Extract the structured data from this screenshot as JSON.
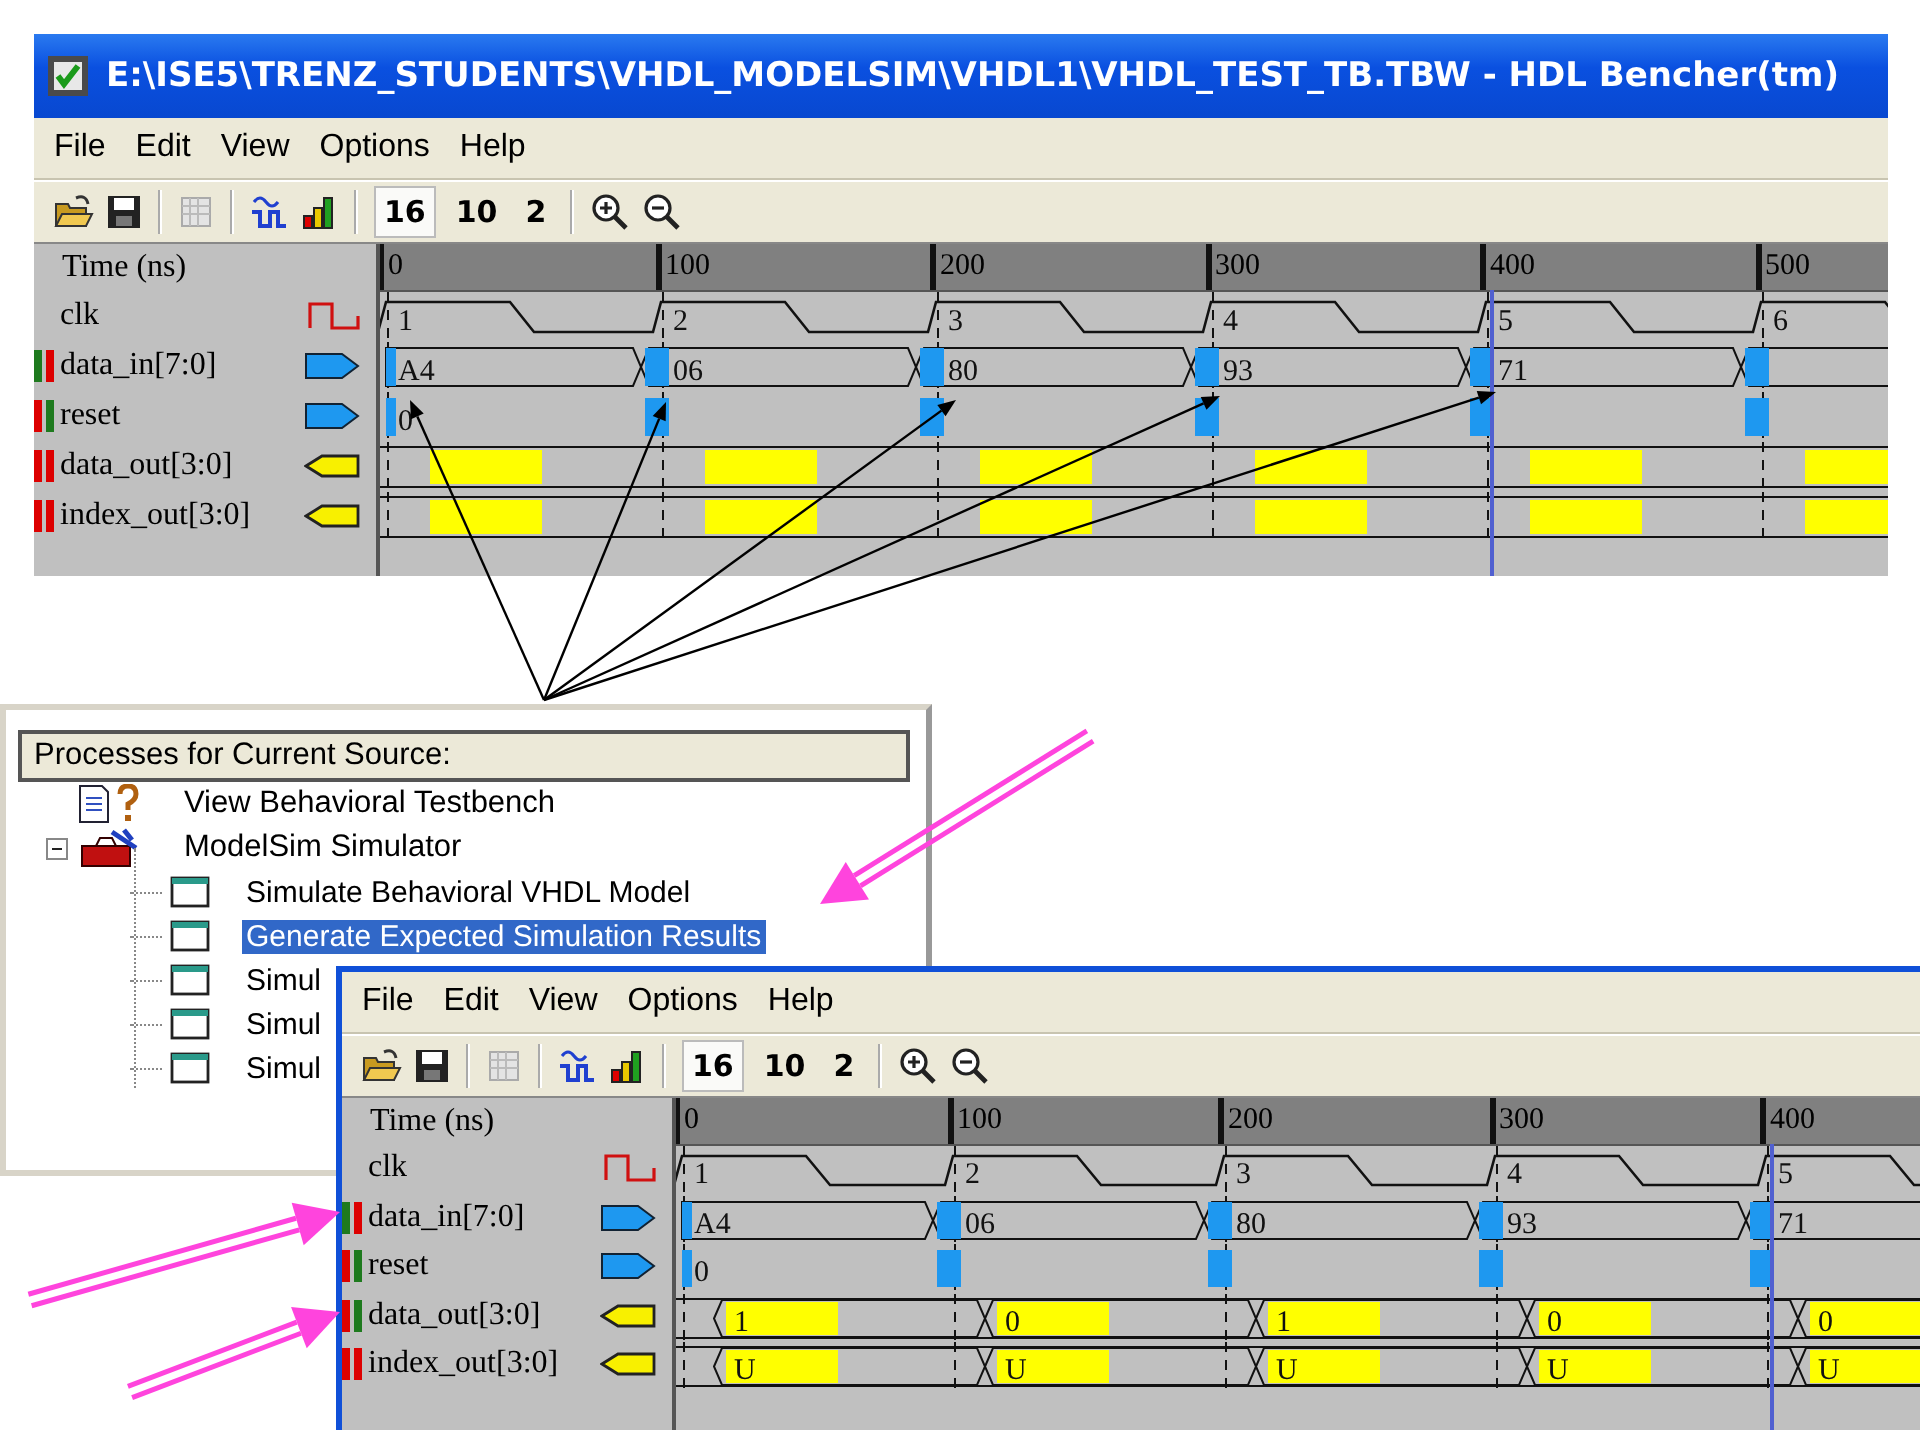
{
  "top_window": {
    "title": "E:\\ISE5\\TRENZ_STUDENTS\\VHDL_MODELSIM\\VHDL1\\VHDL_TEST_TB.TBW - HDL Bencher(tm)",
    "menu": [
      "File",
      "Edit",
      "View",
      "Options",
      "Help"
    ],
    "radix_buttons": [
      {
        "label": "16",
        "selected": true
      },
      {
        "label": "10",
        "selected": false
      },
      {
        "label": "2",
        "selected": false
      }
    ],
    "time_label": "Time (ns)",
    "ticks": [
      {
        "label": "0",
        "cursor": false
      },
      {
        "label": "100",
        "cursor": false
      },
      {
        "label": "200",
        "cursor": false
      },
      {
        "label": "300",
        "cursor": false
      },
      {
        "label": "400",
        "cursor": true
      },
      {
        "label": "500",
        "cursor": false
      }
    ],
    "signals": [
      {
        "name": "clk",
        "kind": "clock",
        "segments": [
          {
            "value": "1"
          },
          {
            "value": "2"
          },
          {
            "value": "3"
          },
          {
            "value": "4"
          },
          {
            "value": "5"
          },
          {
            "value": "6"
          }
        ]
      },
      {
        "name": "data_in[7:0]",
        "kind": "input_bus",
        "markers": [
          {
            "color": "#1e7a1e"
          },
          {
            "color": "#dd0000"
          }
        ],
        "segments": [
          {
            "value": "A4",
            "highlighted": true
          },
          {
            "value": "06",
            "highlighted": true
          },
          {
            "value": "80",
            "highlighted": true
          },
          {
            "value": "93",
            "highlighted": true
          },
          {
            "value": "71",
            "highlighted": true
          },
          {
            "highlighted": true
          }
        ]
      },
      {
        "name": "reset",
        "kind": "input_bit",
        "markers": [
          {
            "color": "#dd0000"
          },
          {
            "color": "#1e7a1e"
          }
        ],
        "segments": [
          {
            "value": "0",
            "highlighted": true
          },
          {
            "highlighted": true
          },
          {
            "highlighted": true
          },
          {
            "highlighted": true
          },
          {
            "highlighted": true
          },
          {
            "highlighted": true
          }
        ]
      },
      {
        "name": "data_out[3:0]",
        "kind": "output",
        "markers": [
          {
            "color": "#dd0000"
          },
          {
            "color": "#dd0000"
          }
        ],
        "segments": [
          {
            "highlighted": true
          },
          {
            "highlighted": true
          },
          {
            "highlighted": true
          },
          {
            "highlighted": true
          },
          {
            "highlighted": true
          },
          {
            "highlighted": true
          }
        ]
      },
      {
        "name": "index_out[3:0]",
        "kind": "output",
        "markers": [
          {
            "color": "#dd0000"
          },
          {
            "color": "#dd0000"
          }
        ],
        "segments": [
          {
            "highlighted": true
          },
          {
            "highlighted": true
          },
          {
            "highlighted": true
          },
          {
            "highlighted": true
          },
          {
            "highlighted": true
          },
          {
            "highlighted": true
          }
        ]
      }
    ]
  },
  "process_panel": {
    "header": "Processes for Current Source:",
    "tree": [
      {
        "label": "View Behavioral Testbench",
        "selected": false
      },
      {
        "label": "ModelSim Simulator",
        "selected": false,
        "expanded": true,
        "children": [
          {
            "label": "Simulate Behavioral VHDL Model",
            "selected": false
          },
          {
            "label": "Generate Expected Simulation Results",
            "selected": true
          },
          {
            "label": "Simul",
            "selected": false
          },
          {
            "label": "Simul",
            "selected": false
          },
          {
            "label": "Simul",
            "selected": false
          }
        ]
      }
    ]
  },
  "bottom_window": {
    "menu": [
      "File",
      "Edit",
      "View",
      "Options",
      "Help"
    ],
    "radix_buttons": [
      {
        "label": "16",
        "selected": true
      },
      {
        "label": "10",
        "selected": false
      },
      {
        "label": "2",
        "selected": false
      }
    ],
    "time_label": "Time (ns)",
    "ticks": [
      {
        "label": "0",
        "cursor": false
      },
      {
        "label": "100",
        "cursor": false
      },
      {
        "label": "200",
        "cursor": false
      },
      {
        "label": "300",
        "cursor": false
      },
      {
        "label": "400",
        "cursor": true
      }
    ],
    "signals": [
      {
        "name": "clk",
        "kind": "clock",
        "segments": [
          {
            "value": "1"
          },
          {
            "value": "2"
          },
          {
            "value": "3"
          },
          {
            "value": "4"
          },
          {
            "value": "5"
          }
        ]
      },
      {
        "name": "data_in[7:0]",
        "kind": "input_bus",
        "markers": [
          {
            "color": "#1e7a1e"
          },
          {
            "color": "#dd0000"
          }
        ],
        "segments": [
          {
            "value": "A4",
            "highlighted": true
          },
          {
            "value": "06",
            "highlighted": true
          },
          {
            "value": "80",
            "highlighted": true
          },
          {
            "value": "93",
            "highlighted": true
          },
          {
            "value": "71",
            "highlighted": true
          }
        ]
      },
      {
        "name": "reset",
        "kind": "input_bit",
        "markers": [
          {
            "color": "#dd0000"
          },
          {
            "color": "#1e7a1e"
          }
        ],
        "segments": [
          {
            "value": "0",
            "highlighted": true
          },
          {
            "highlighted": true
          },
          {
            "highlighted": true
          },
          {
            "highlighted": true
          },
          {
            "highlighted": true
          }
        ]
      },
      {
        "name": "data_out[3:0]",
        "kind": "output",
        "markers": [
          {
            "color": "#dd0000"
          },
          {
            "color": "#1e7a1e"
          }
        ],
        "segments": [
          {
            "value": "1",
            "highlighted": true
          },
          {
            "value": "0",
            "highlighted": true
          },
          {
            "value": "1",
            "highlighted": true
          },
          {
            "value": "0",
            "highlighted": true
          },
          {
            "value": "0",
            "highlighted": true
          }
        ]
      },
      {
        "name": "index_out[3:0]",
        "kind": "output",
        "markers": [
          {
            "color": "#dd0000"
          },
          {
            "color": "#dd0000"
          }
        ],
        "segments": [
          {
            "value": "U",
            "highlighted": true
          },
          {
            "value": "U",
            "highlighted": true
          },
          {
            "value": "U",
            "highlighted": true
          },
          {
            "value": "U",
            "highlighted": true
          },
          {
            "value": "U",
            "highlighted": true
          }
        ]
      }
    ]
  }
}
